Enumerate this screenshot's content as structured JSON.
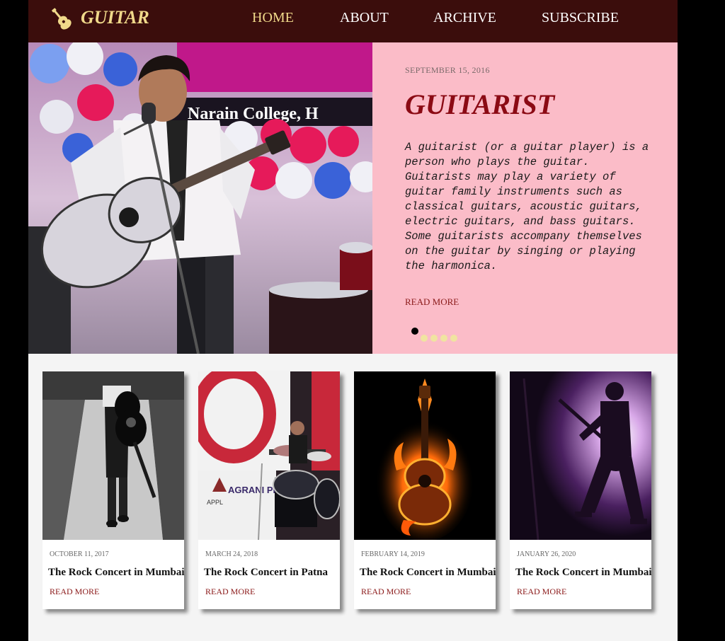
{
  "brand": {
    "name": "GUITAR"
  },
  "nav": {
    "items": [
      "HOME",
      "ABOUT",
      "ARCHIVE",
      "SUBSCRIBE"
    ]
  },
  "hero": {
    "date": "SEPTEMBER 15, 2016",
    "title": "GUITARIST",
    "text": "A guitarist (or a guitar player) is a person who plays the guitar. Guitarists may play a variety of guitar family instruments such as classical guitars, acoustic guitars, electric guitars, and bass guitars. Some guitarists accompany themselves on the guitar by singing or playing the harmonica.",
    "read_more": "READ MORE",
    "banner_text": "Narain College, H"
  },
  "cards": [
    {
      "date": "OCTOBER 11, 2017",
      "title": "The Rock Concert in Mumbai",
      "read_more": "READ MORE"
    },
    {
      "date": "MARCH 24, 2018",
      "title": "The Rock Concert in Patna",
      "read_more": "READ MORE"
    },
    {
      "date": "FEBRUARY 14, 2019",
      "title": "The Rock Concert in Mumbai",
      "read_more": "READ MORE"
    },
    {
      "date": "JANUARY 26, 2020",
      "title": "The Rock Concert in Mumbai",
      "read_more": "READ MORE"
    }
  ],
  "card_image_text": {
    "sign": "AGRANI PHARMA",
    "logo": "APPL"
  },
  "colors": {
    "nav_bg": "#3b0d0c",
    "accent": "#f0d98a",
    "hero_panel": "#fbbcc8",
    "title_red": "#8b0a14",
    "link": "#8b1a1a"
  }
}
